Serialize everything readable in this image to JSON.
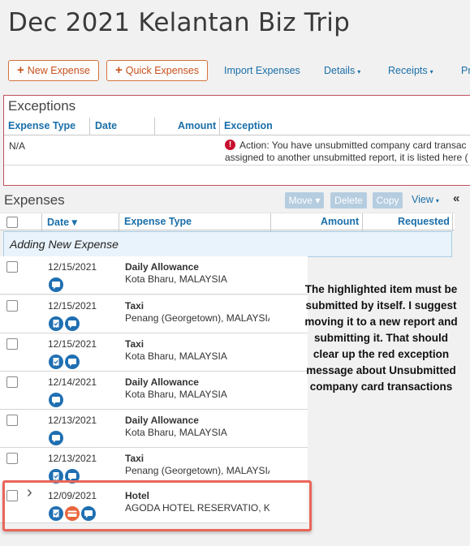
{
  "report_title": "Dec 2021 Kelantan Biz Trip",
  "toolbar": {
    "new_expense": "New Expense",
    "quick_expenses": "Quick Expenses",
    "import_expenses": "Import Expenses",
    "details": "Details",
    "receipts": "Receipts",
    "print_partial": "Pr",
    "caret": "▾"
  },
  "exceptions": {
    "title": "Exceptions",
    "columns": [
      "Expense Type",
      "Date",
      "Amount",
      "Exception"
    ],
    "row": {
      "expense_type": "N/A",
      "message_line1": "Action: You have unsubmitted company card transac",
      "message_line2": "assigned to another unsubmitted report, it is listed here ("
    }
  },
  "expenses": {
    "title": "Expenses",
    "actions": {
      "move": "Move ▾",
      "delete": "Delete",
      "copy": "Copy",
      "view": "View",
      "view_caret": "▾",
      "collapse": "«"
    },
    "columns": {
      "date": "Date ▾",
      "expense_type": "Expense Type",
      "amount": "Amount",
      "requested": "Requested"
    },
    "adding_label": "Adding New Expense",
    "rows": [
      {
        "date": "12/15/2021",
        "type": "Daily Allowance",
        "location": "Kota Bharu, MALAYSIA",
        "icons": [
          "comment-icon"
        ]
      },
      {
        "date": "12/15/2021",
        "type": "Taxi",
        "location": "Penang (Georgetown), MALAYSIA",
        "icons": [
          "receipt-icon",
          "comment-icon"
        ]
      },
      {
        "date": "12/15/2021",
        "type": "Taxi",
        "location": "Kota Bharu, MALAYSIA",
        "icons": [
          "receipt-icon",
          "comment-icon"
        ]
      },
      {
        "date": "12/14/2021",
        "type": "Daily Allowance",
        "location": "Kota Bharu, MALAYSIA",
        "icons": [
          "comment-icon"
        ]
      },
      {
        "date": "12/13/2021",
        "type": "Daily Allowance",
        "location": "Kota Bharu, MALAYSIA",
        "icons": [
          "comment-icon"
        ]
      },
      {
        "date": "12/13/2021",
        "type": "Taxi",
        "location": "Penang (Georgetown), MALAYSIA",
        "icons": [
          "receipt-icon",
          "comment-icon"
        ]
      },
      {
        "date": "12/09/2021",
        "type": "Hotel",
        "location": "AGODA HOTEL RESERVATIO, Ko",
        "icons": [
          "receipt-icon",
          "card-icon",
          "comment-icon"
        ]
      }
    ]
  },
  "note": "The highlighted item must be submitted by itself. I suggest moving it to a new report and submitting it. That should clear up the red exception message about Unsubmitted company card transactions",
  "colors": {
    "accent": "#c8511c",
    "link": "#1a6fa9",
    "error": "#c8102e",
    "highlight": "#e9665a",
    "icon_blue": "#1f6fb2",
    "icon_orange": "#e8643c"
  }
}
